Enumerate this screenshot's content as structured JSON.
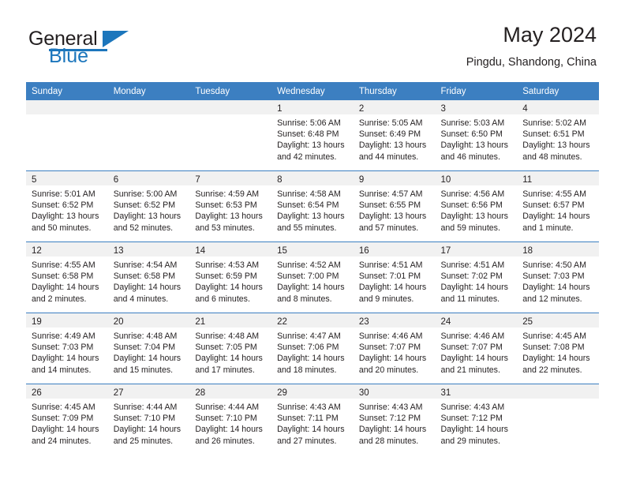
{
  "brand": {
    "name_top": "General",
    "name_bottom": "Blue",
    "accent_color": "#1c76bc"
  },
  "header": {
    "title": "May 2024",
    "location": "Pingdu, Shandong, China",
    "header_bg_color": "#3c7fc1",
    "daynum_band_color": "#f1f1f1"
  },
  "weekdays": [
    "Sunday",
    "Monday",
    "Tuesday",
    "Wednesday",
    "Thursday",
    "Friday",
    "Saturday"
  ],
  "weeks": [
    [
      {
        "day": "",
        "sunrise": "",
        "sunset": "",
        "daylight1": "",
        "daylight2": ""
      },
      {
        "day": "",
        "sunrise": "",
        "sunset": "",
        "daylight1": "",
        "daylight2": ""
      },
      {
        "day": "",
        "sunrise": "",
        "sunset": "",
        "daylight1": "",
        "daylight2": ""
      },
      {
        "day": "1",
        "sunrise": "Sunrise: 5:06 AM",
        "sunset": "Sunset: 6:48 PM",
        "daylight1": "Daylight: 13 hours",
        "daylight2": "and 42 minutes."
      },
      {
        "day": "2",
        "sunrise": "Sunrise: 5:05 AM",
        "sunset": "Sunset: 6:49 PM",
        "daylight1": "Daylight: 13 hours",
        "daylight2": "and 44 minutes."
      },
      {
        "day": "3",
        "sunrise": "Sunrise: 5:03 AM",
        "sunset": "Sunset: 6:50 PM",
        "daylight1": "Daylight: 13 hours",
        "daylight2": "and 46 minutes."
      },
      {
        "day": "4",
        "sunrise": "Sunrise: 5:02 AM",
        "sunset": "Sunset: 6:51 PM",
        "daylight1": "Daylight: 13 hours",
        "daylight2": "and 48 minutes."
      }
    ],
    [
      {
        "day": "5",
        "sunrise": "Sunrise: 5:01 AM",
        "sunset": "Sunset: 6:52 PM",
        "daylight1": "Daylight: 13 hours",
        "daylight2": "and 50 minutes."
      },
      {
        "day": "6",
        "sunrise": "Sunrise: 5:00 AM",
        "sunset": "Sunset: 6:52 PM",
        "daylight1": "Daylight: 13 hours",
        "daylight2": "and 52 minutes."
      },
      {
        "day": "7",
        "sunrise": "Sunrise: 4:59 AM",
        "sunset": "Sunset: 6:53 PM",
        "daylight1": "Daylight: 13 hours",
        "daylight2": "and 53 minutes."
      },
      {
        "day": "8",
        "sunrise": "Sunrise: 4:58 AM",
        "sunset": "Sunset: 6:54 PM",
        "daylight1": "Daylight: 13 hours",
        "daylight2": "and 55 minutes."
      },
      {
        "day": "9",
        "sunrise": "Sunrise: 4:57 AM",
        "sunset": "Sunset: 6:55 PM",
        "daylight1": "Daylight: 13 hours",
        "daylight2": "and 57 minutes."
      },
      {
        "day": "10",
        "sunrise": "Sunrise: 4:56 AM",
        "sunset": "Sunset: 6:56 PM",
        "daylight1": "Daylight: 13 hours",
        "daylight2": "and 59 minutes."
      },
      {
        "day": "11",
        "sunrise": "Sunrise: 4:55 AM",
        "sunset": "Sunset: 6:57 PM",
        "daylight1": "Daylight: 14 hours",
        "daylight2": "and 1 minute."
      }
    ],
    [
      {
        "day": "12",
        "sunrise": "Sunrise: 4:55 AM",
        "sunset": "Sunset: 6:58 PM",
        "daylight1": "Daylight: 14 hours",
        "daylight2": "and 2 minutes."
      },
      {
        "day": "13",
        "sunrise": "Sunrise: 4:54 AM",
        "sunset": "Sunset: 6:58 PM",
        "daylight1": "Daylight: 14 hours",
        "daylight2": "and 4 minutes."
      },
      {
        "day": "14",
        "sunrise": "Sunrise: 4:53 AM",
        "sunset": "Sunset: 6:59 PM",
        "daylight1": "Daylight: 14 hours",
        "daylight2": "and 6 minutes."
      },
      {
        "day": "15",
        "sunrise": "Sunrise: 4:52 AM",
        "sunset": "Sunset: 7:00 PM",
        "daylight1": "Daylight: 14 hours",
        "daylight2": "and 8 minutes."
      },
      {
        "day": "16",
        "sunrise": "Sunrise: 4:51 AM",
        "sunset": "Sunset: 7:01 PM",
        "daylight1": "Daylight: 14 hours",
        "daylight2": "and 9 minutes."
      },
      {
        "day": "17",
        "sunrise": "Sunrise: 4:51 AM",
        "sunset": "Sunset: 7:02 PM",
        "daylight1": "Daylight: 14 hours",
        "daylight2": "and 11 minutes."
      },
      {
        "day": "18",
        "sunrise": "Sunrise: 4:50 AM",
        "sunset": "Sunset: 7:03 PM",
        "daylight1": "Daylight: 14 hours",
        "daylight2": "and 12 minutes."
      }
    ],
    [
      {
        "day": "19",
        "sunrise": "Sunrise: 4:49 AM",
        "sunset": "Sunset: 7:03 PM",
        "daylight1": "Daylight: 14 hours",
        "daylight2": "and 14 minutes."
      },
      {
        "day": "20",
        "sunrise": "Sunrise: 4:48 AM",
        "sunset": "Sunset: 7:04 PM",
        "daylight1": "Daylight: 14 hours",
        "daylight2": "and 15 minutes."
      },
      {
        "day": "21",
        "sunrise": "Sunrise: 4:48 AM",
        "sunset": "Sunset: 7:05 PM",
        "daylight1": "Daylight: 14 hours",
        "daylight2": "and 17 minutes."
      },
      {
        "day": "22",
        "sunrise": "Sunrise: 4:47 AM",
        "sunset": "Sunset: 7:06 PM",
        "daylight1": "Daylight: 14 hours",
        "daylight2": "and 18 minutes."
      },
      {
        "day": "23",
        "sunrise": "Sunrise: 4:46 AM",
        "sunset": "Sunset: 7:07 PM",
        "daylight1": "Daylight: 14 hours",
        "daylight2": "and 20 minutes."
      },
      {
        "day": "24",
        "sunrise": "Sunrise: 4:46 AM",
        "sunset": "Sunset: 7:07 PM",
        "daylight1": "Daylight: 14 hours",
        "daylight2": "and 21 minutes."
      },
      {
        "day": "25",
        "sunrise": "Sunrise: 4:45 AM",
        "sunset": "Sunset: 7:08 PM",
        "daylight1": "Daylight: 14 hours",
        "daylight2": "and 22 minutes."
      }
    ],
    [
      {
        "day": "26",
        "sunrise": "Sunrise: 4:45 AM",
        "sunset": "Sunset: 7:09 PM",
        "daylight1": "Daylight: 14 hours",
        "daylight2": "and 24 minutes."
      },
      {
        "day": "27",
        "sunrise": "Sunrise: 4:44 AM",
        "sunset": "Sunset: 7:10 PM",
        "daylight1": "Daylight: 14 hours",
        "daylight2": "and 25 minutes."
      },
      {
        "day": "28",
        "sunrise": "Sunrise: 4:44 AM",
        "sunset": "Sunset: 7:10 PM",
        "daylight1": "Daylight: 14 hours",
        "daylight2": "and 26 minutes."
      },
      {
        "day": "29",
        "sunrise": "Sunrise: 4:43 AM",
        "sunset": "Sunset: 7:11 PM",
        "daylight1": "Daylight: 14 hours",
        "daylight2": "and 27 minutes."
      },
      {
        "day": "30",
        "sunrise": "Sunrise: 4:43 AM",
        "sunset": "Sunset: 7:12 PM",
        "daylight1": "Daylight: 14 hours",
        "daylight2": "and 28 minutes."
      },
      {
        "day": "31",
        "sunrise": "Sunrise: 4:43 AM",
        "sunset": "Sunset: 7:12 PM",
        "daylight1": "Daylight: 14 hours",
        "daylight2": "and 29 minutes."
      },
      {
        "day": "",
        "sunrise": "",
        "sunset": "",
        "daylight1": "",
        "daylight2": ""
      }
    ]
  ]
}
